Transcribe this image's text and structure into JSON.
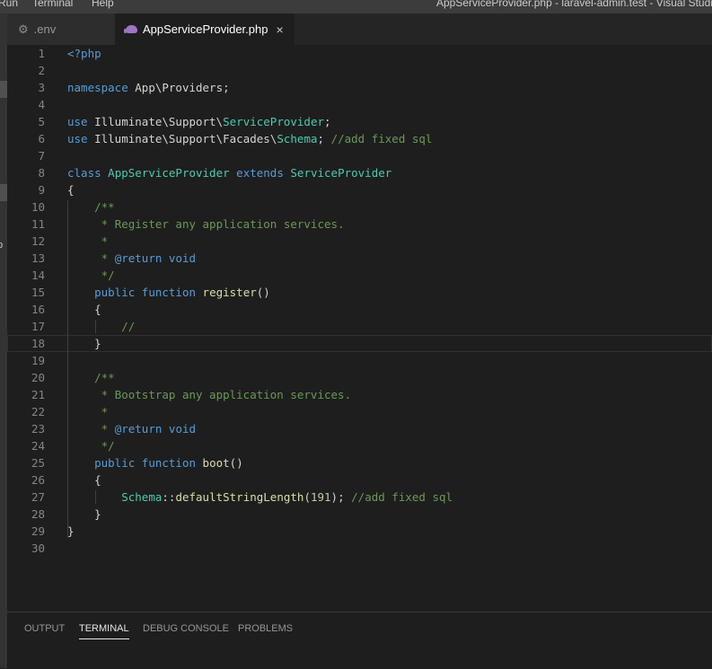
{
  "menubar": {
    "items": [
      "Run",
      "Terminal",
      "Help"
    ],
    "window_title": "AppServiceProvider.php - laravel-admin.test - Visual Studio Code"
  },
  "tabs": [
    {
      "label": ".env",
      "icon": "gear-icon",
      "active": false
    },
    {
      "label": "AppServiceProvider.php",
      "icon": "php-elephant-icon",
      "active": true,
      "close": "×"
    }
  ],
  "editor": {
    "current_line": 18,
    "lines": [
      {
        "num": "1",
        "text": "<?php"
      },
      {
        "num": "2",
        "text": ""
      },
      {
        "num": "3",
        "text": "namespace App\\Providers;"
      },
      {
        "num": "4",
        "text": ""
      },
      {
        "num": "5",
        "text": "use Illuminate\\Support\\ServiceProvider;"
      },
      {
        "num": "6",
        "text": "use Illuminate\\Support\\Facades\\Schema; //add fixed sql"
      },
      {
        "num": "7",
        "text": ""
      },
      {
        "num": "8",
        "text": "class AppServiceProvider extends ServiceProvider"
      },
      {
        "num": "9",
        "text": "{"
      },
      {
        "num": "10",
        "text": "    /**"
      },
      {
        "num": "11",
        "text": "     * Register any application services."
      },
      {
        "num": "12",
        "text": "     *"
      },
      {
        "num": "13",
        "text": "     * @return void"
      },
      {
        "num": "14",
        "text": "     */"
      },
      {
        "num": "15",
        "text": "    public function register()"
      },
      {
        "num": "16",
        "text": "    {"
      },
      {
        "num": "17",
        "text": "        //"
      },
      {
        "num": "18",
        "text": "    }"
      },
      {
        "num": "19",
        "text": ""
      },
      {
        "num": "20",
        "text": "    /**"
      },
      {
        "num": "21",
        "text": "     * Bootstrap any application services."
      },
      {
        "num": "22",
        "text": "     *"
      },
      {
        "num": "23",
        "text": "     * @return void"
      },
      {
        "num": "24",
        "text": "     */"
      },
      {
        "num": "25",
        "text": "    public function boot()"
      },
      {
        "num": "26",
        "text": "    {"
      },
      {
        "num": "27",
        "text": "        Schema::defaultStringLength(191); //add fixed sql"
      },
      {
        "num": "28",
        "text": "    }"
      },
      {
        "num": "29",
        "text": "}"
      },
      {
        "num": "30",
        "text": ""
      }
    ]
  },
  "panel": {
    "tabs": [
      "OUTPUT",
      "TERMINAL",
      "DEBUG CONSOLE",
      "PROBLEMS"
    ],
    "active": "TERMINAL"
  },
  "colors": {
    "keyword": "#569cd6",
    "type": "#4ec9b0",
    "function": "#dcdcaa",
    "comment": "#6a9955",
    "number": "#b5cea8",
    "plain": "#d4d4d4",
    "line_number": "#858585"
  }
}
